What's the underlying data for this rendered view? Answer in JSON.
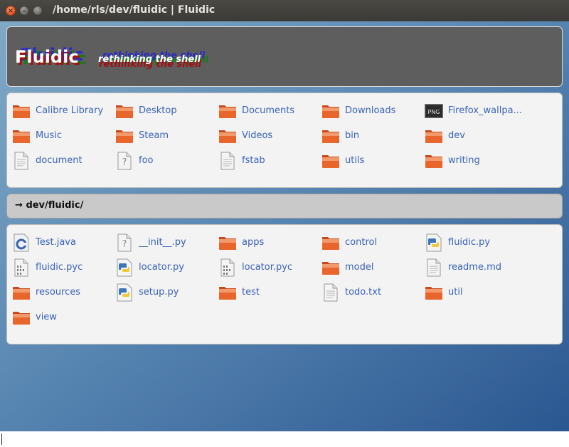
{
  "window": {
    "title": "/home/rls/dev/fluidic | Fluidic"
  },
  "banner": {
    "logo": "Fluidic",
    "tagline": "rethinking the shell"
  },
  "home_items": [
    {
      "name": "Calibre Library",
      "icon": "folder-icon"
    },
    {
      "name": "Desktop",
      "icon": "folder-icon"
    },
    {
      "name": "Documents",
      "icon": "folder-icon"
    },
    {
      "name": "Downloads",
      "icon": "folder-icon"
    },
    {
      "name": "Firefox_wallpa...",
      "icon": "png-icon"
    },
    {
      "name": "Music",
      "icon": "folder-icon"
    },
    {
      "name": "Steam",
      "icon": "folder-icon"
    },
    {
      "name": "Videos",
      "icon": "folder-icon"
    },
    {
      "name": "bin",
      "icon": "folder-icon"
    },
    {
      "name": "dev",
      "icon": "folder-icon"
    },
    {
      "name": "document",
      "icon": "text-file-icon"
    },
    {
      "name": "foo",
      "icon": "unknown-file-icon"
    },
    {
      "name": "fstab",
      "icon": "text-file-icon"
    },
    {
      "name": "utils",
      "icon": "folder-icon"
    },
    {
      "name": "writing",
      "icon": "folder-icon"
    }
  ],
  "path": {
    "arrow": "→",
    "current": "dev/fluidic/"
  },
  "dir_items": [
    {
      "name": "Test.java",
      "icon": "java-file-icon"
    },
    {
      "name": "__init__.py",
      "icon": "unknown-file-icon"
    },
    {
      "name": "apps",
      "icon": "folder-icon"
    },
    {
      "name": "control",
      "icon": "folder-icon"
    },
    {
      "name": "fluidic.py",
      "icon": "python-file-icon"
    },
    {
      "name": "fluidic.pyc",
      "icon": "binary-file-icon"
    },
    {
      "name": "locator.py",
      "icon": "python-file-icon"
    },
    {
      "name": "locator.pyc",
      "icon": "binary-file-icon"
    },
    {
      "name": "model",
      "icon": "folder-icon"
    },
    {
      "name": "readme.md",
      "icon": "text-file-icon"
    },
    {
      "name": "resources",
      "icon": "folder-icon"
    },
    {
      "name": "setup.py",
      "icon": "python-file-icon"
    },
    {
      "name": "test",
      "icon": "folder-icon"
    },
    {
      "name": "todo.txt",
      "icon": "text-file-icon"
    },
    {
      "name": "util",
      "icon": "folder-icon"
    },
    {
      "name": "view",
      "icon": "folder-icon"
    }
  ],
  "colors": {
    "link": "#3a62b8",
    "folder": "#e8652c",
    "banner_bg": "#5e5e5e",
    "close": "#e2541f"
  }
}
